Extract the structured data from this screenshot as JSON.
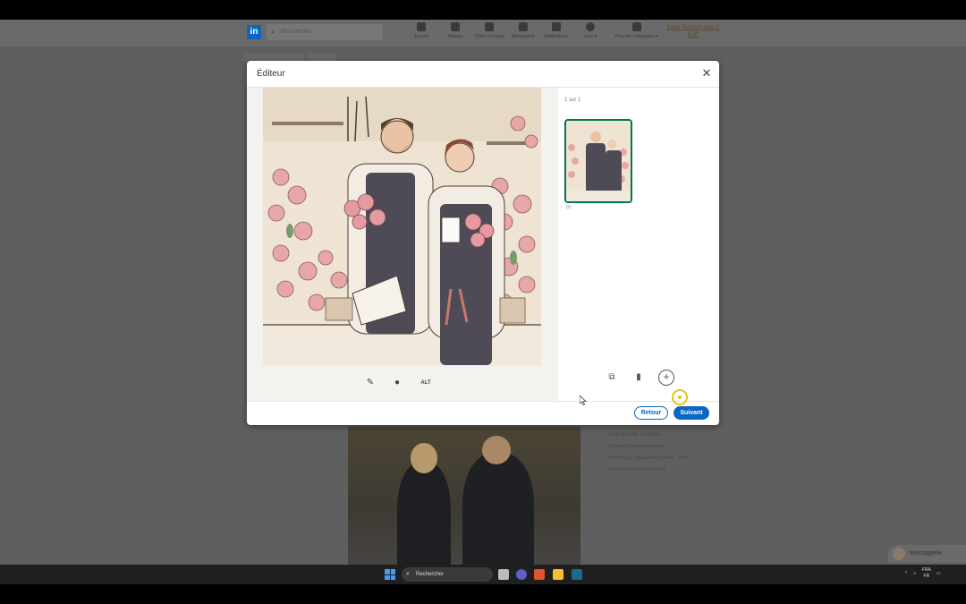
{
  "linkedin": {
    "search_placeholder": "Recherche",
    "nav": [
      {
        "label": "Accueil",
        "icon": "home-icon"
      },
      {
        "label": "Réseau",
        "icon": "network-icon"
      },
      {
        "label": "Offres d'emploi",
        "icon": "jobs-icon"
      },
      {
        "label": "Messagerie",
        "icon": "messaging-icon"
      },
      {
        "label": "Notifications",
        "icon": "bell-icon"
      },
      {
        "label": "Vous ▾",
        "icon": "avatar-icon"
      },
      {
        "label": "Pour les entreprises ▾",
        "icon": "grid-icon"
      }
    ],
    "premium": "Essai Premium pour 0 EUR",
    "footer_lines": [
      "Publicités Aide · Publicités",
      "Solutions professionnelles ▾",
      "Télécharger l'application LinkedIn · Plus",
      "LinkedIn Corporation © 2023"
    ],
    "messaging": "Messagerie"
  },
  "modal": {
    "title": "Éditeur",
    "counter": "1 sur 1",
    "thumb_number": "01",
    "tools": {
      "alt_label": "ALT"
    },
    "back_label": "Retour",
    "next_label": "Suivant"
  },
  "taskbar": {
    "search_placeholder": "Rechercher",
    "lang_top": "FRA",
    "lang_bottom": "FR"
  },
  "colors": {
    "accent": "#0a66c2",
    "thumb_border": "#01754f",
    "cursor_highlight": "#e8c21a"
  }
}
